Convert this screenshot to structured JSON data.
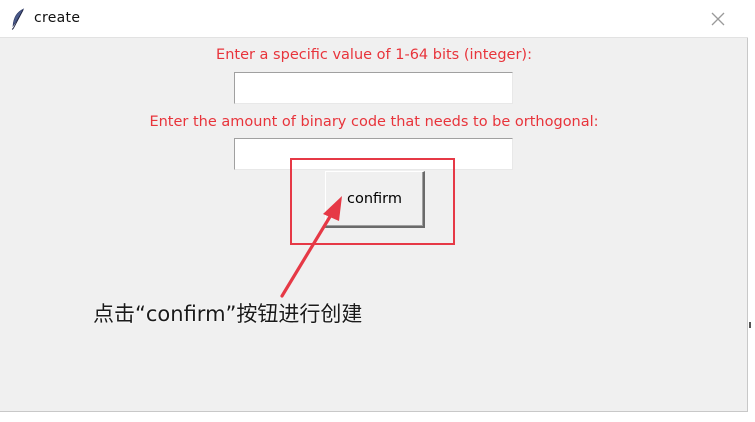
{
  "window": {
    "title": "create"
  },
  "form": {
    "prompt1": "Enter a specific value of 1-64 bits (integer):",
    "input1_value": "",
    "prompt2": "Enter the amount of binary code that needs to be orthogonal:",
    "input2_value": "",
    "confirm_label": "confirm"
  },
  "annotation": {
    "text": "点击“confirm”按钮进行创建"
  },
  "colors": {
    "prompt_text": "#e8343b",
    "annotation_red": "#e63946",
    "window_bg": "#f0f0f0"
  },
  "icons": {
    "app": "feather-icon",
    "close": "close-icon"
  }
}
